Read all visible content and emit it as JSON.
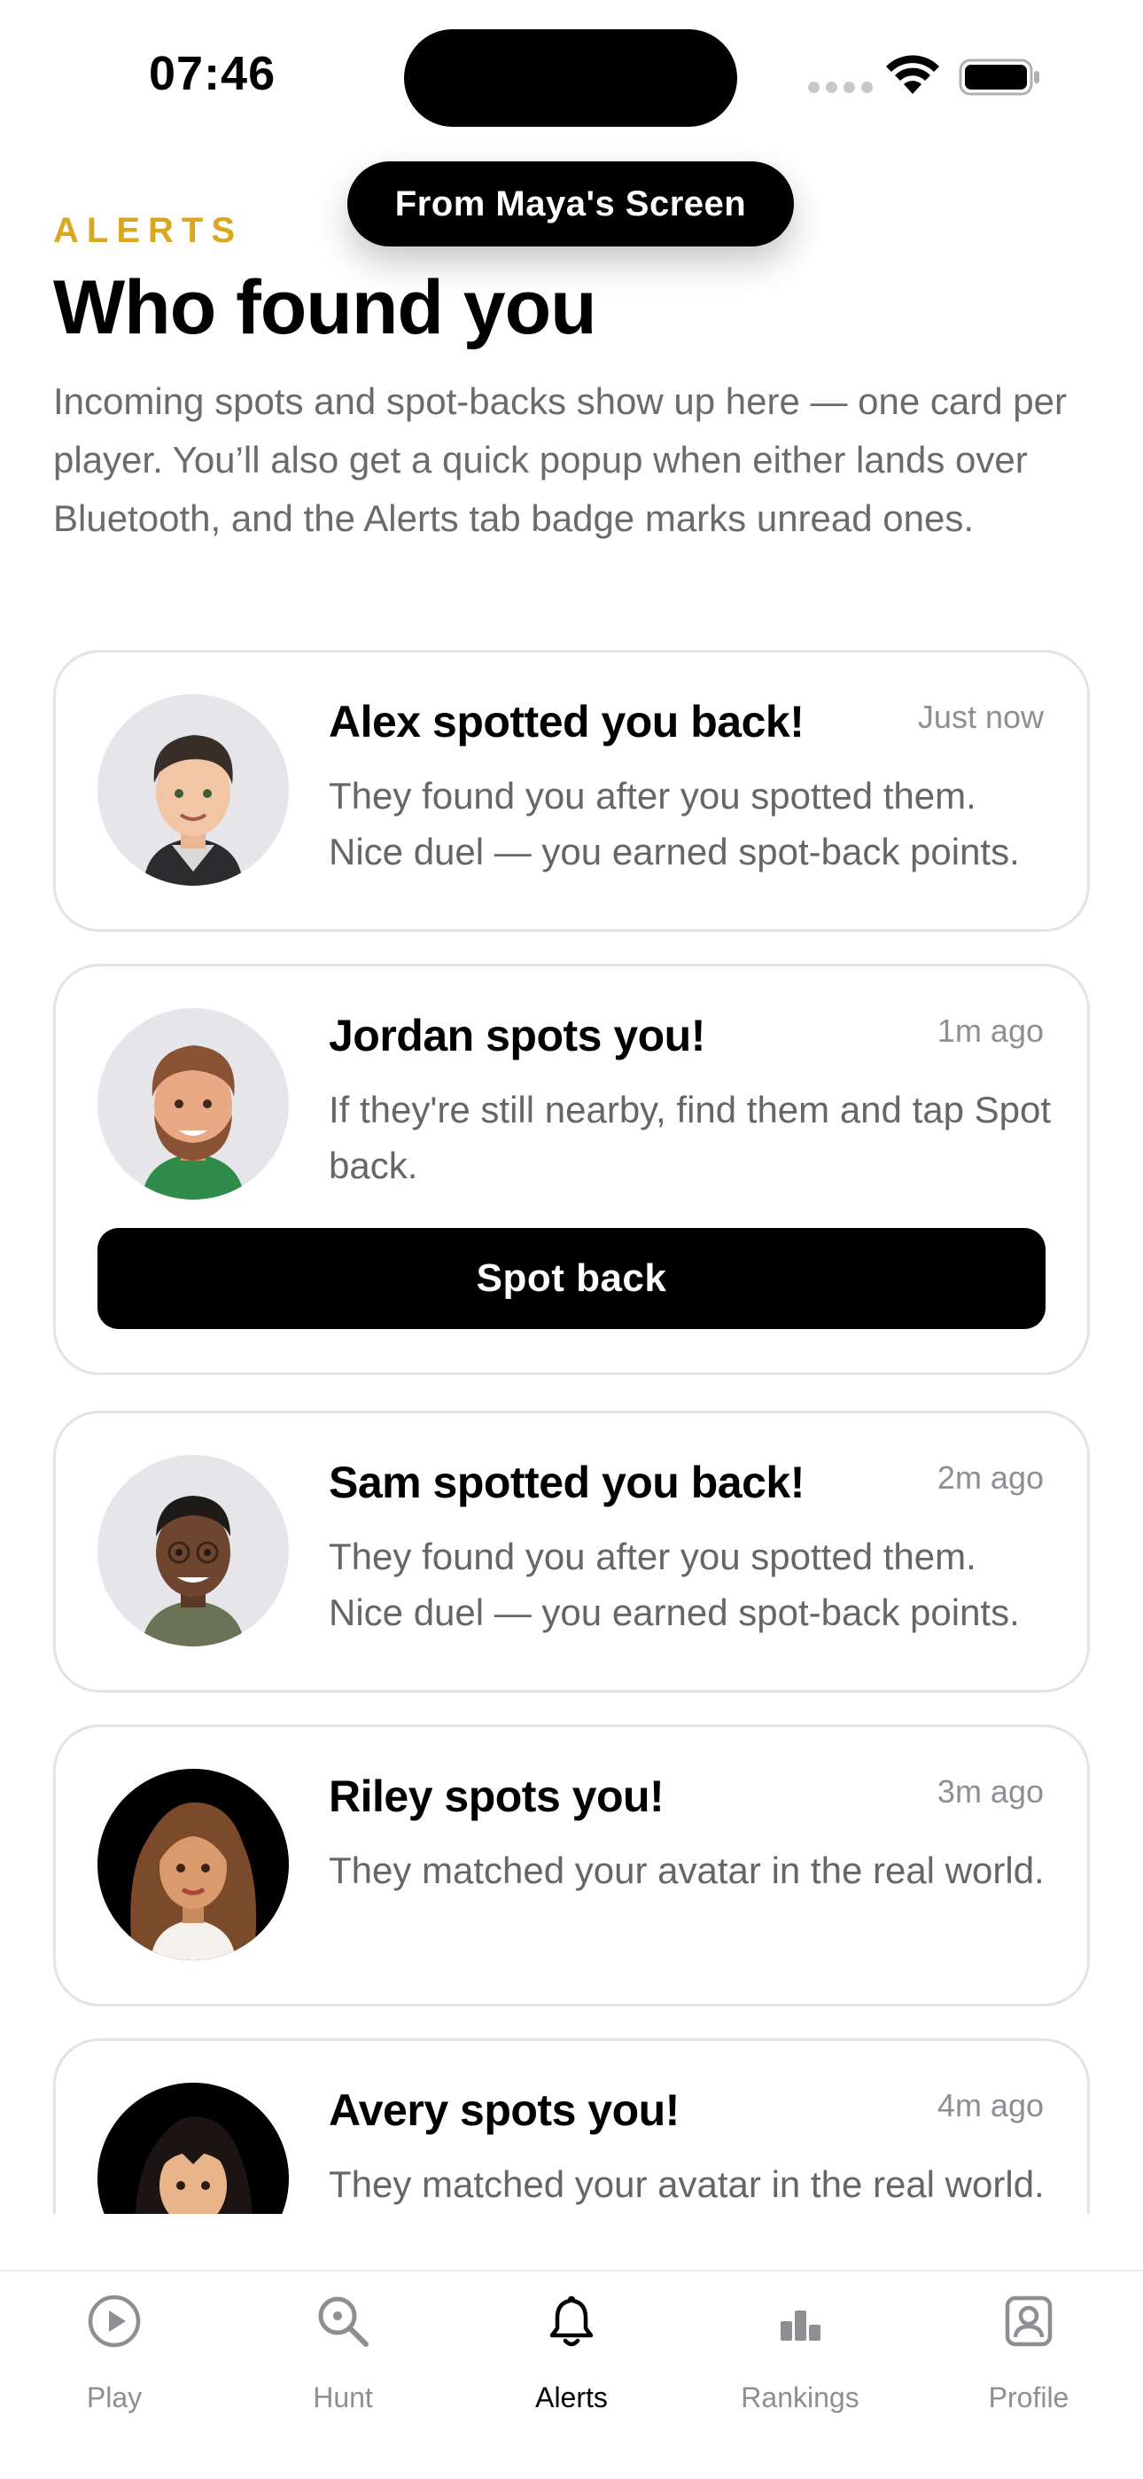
{
  "status_bar": {
    "time": "07:46"
  },
  "share_pill": {
    "label": "From Maya's Screen"
  },
  "header": {
    "eyebrow": "ALERTS",
    "title": "Who found you",
    "description": "Incoming spots and spot-backs show up here — one card per player. You’ll also get a quick popup when either lands over Bluetooth, and the Alerts tab badge marks unread ones."
  },
  "alerts": [
    {
      "title": "Alex spotted you back!",
      "time": "Just now",
      "body": "They found you after you spotted them. Nice duel — you earned spot-back points."
    },
    {
      "title": "Jordan spots you!",
      "time": "1m ago",
      "body": "If they're still nearby, find them and tap Spot back.",
      "action": "Spot back"
    },
    {
      "title": "Sam spotted you back!",
      "time": "2m ago",
      "body": "They found you after you spotted them. Nice duel — you earned spot-back points."
    },
    {
      "title": "Riley spots you!",
      "time": "3m ago",
      "body": "They matched your avatar in the real world."
    },
    {
      "title": "Avery spots you!",
      "time": "4m ago",
      "body": "They matched your avatar in the real world."
    }
  ],
  "tabs": [
    {
      "label": "Play",
      "icon": "play-circle-icon"
    },
    {
      "label": "Hunt",
      "icon": "magnifier-icon"
    },
    {
      "label": "Alerts",
      "icon": "bell-icon",
      "active": true
    },
    {
      "label": "Rankings",
      "icon": "bar-chart-icon"
    },
    {
      "label": "Profile",
      "icon": "person-card-icon"
    }
  ],
  "colors": {
    "accent": "#d9a821",
    "border": "#e3e3e6",
    "muted_text": "#666666",
    "inactive_tab": "#8e8e93"
  }
}
